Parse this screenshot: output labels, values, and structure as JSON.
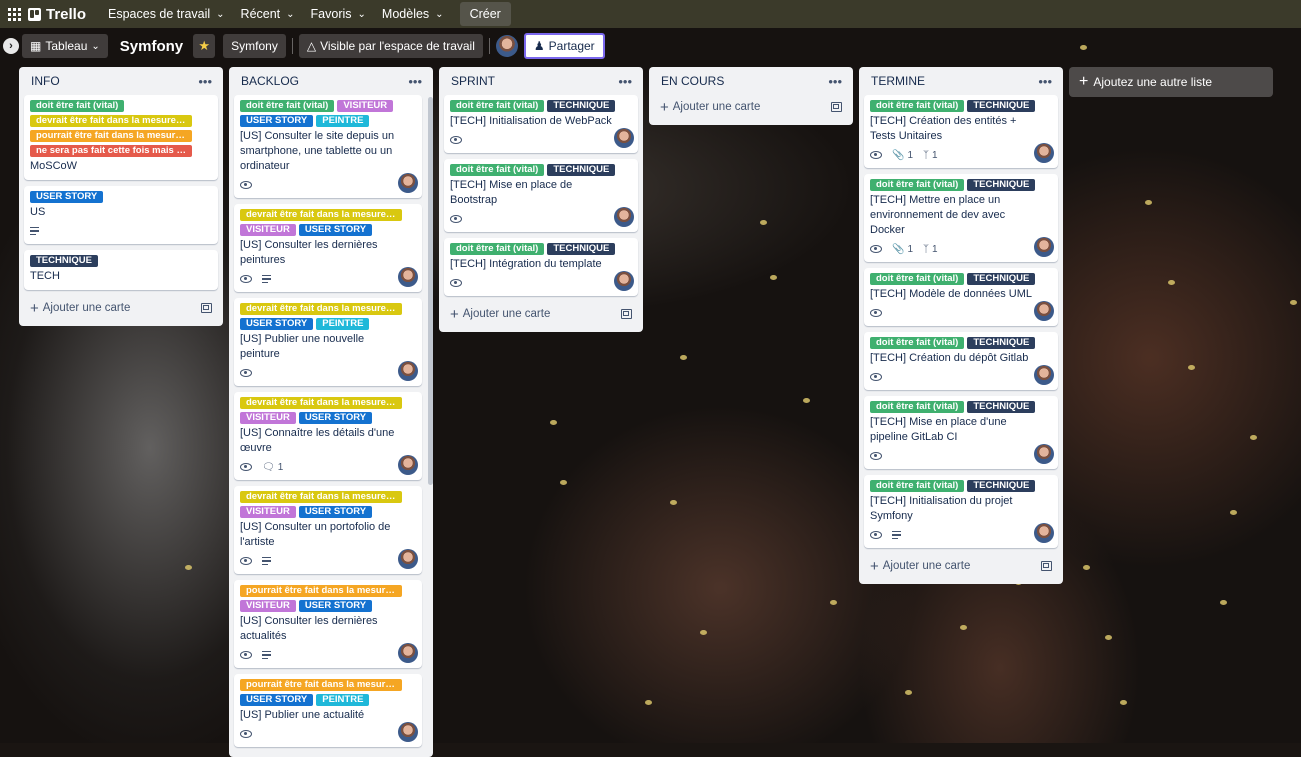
{
  "topnav": {
    "logo": "Trello",
    "items": [
      {
        "label": "Espaces de travail"
      },
      {
        "label": "Récent"
      },
      {
        "label": "Favoris"
      },
      {
        "label": "Modèles"
      }
    ],
    "create": "Créer"
  },
  "board": {
    "view": "Tableau",
    "title": "Symfony",
    "workspace": "Symfony",
    "visibility": "Visible par l'espace de travail",
    "share": "Partager"
  },
  "add_list": "Ajoutez une autre liste",
  "add_card": "Ajouter une carte",
  "lists": [
    {
      "title": "INFO",
      "cards": [
        {
          "labels": [
            {
              "text": "doit être fait (vital)",
              "color": "green"
            },
            {
              "text": "devrait être fait dans la mesure d...",
              "color": "yellow"
            },
            {
              "text": "pourrait être fait dans la mesure ...",
              "color": "orange"
            },
            {
              "text": "ne sera pas fait cette fois mais se...",
              "color": "red"
            }
          ],
          "title": "MoSCoW",
          "badges": []
        },
        {
          "labels": [
            {
              "text": "USER STORY",
              "color": "blue"
            }
          ],
          "title": "US",
          "badges": [
            "desc"
          ]
        },
        {
          "labels": [
            {
              "text": "TECHNIQUE",
              "color": "dark"
            }
          ],
          "title": "TECH",
          "badges": []
        }
      ]
    },
    {
      "title": "BACKLOG",
      "cards": [
        {
          "labels": [
            {
              "text": "doit être fait (vital)",
              "color": "green"
            },
            {
              "text": "VISITEUR",
              "color": "purple"
            },
            {
              "text": "USER STORY",
              "color": "blue"
            },
            {
              "text": "PEINTRE",
              "color": "cyan"
            }
          ],
          "title": "[US] Consulter le site depuis un smartphone, une tablette ou un ordinateur",
          "badges": [
            "watch"
          ],
          "avatar": true
        },
        {
          "labels": [
            {
              "text": "devrait être fait dans la mesure d...",
              "color": "yellow"
            },
            {
              "text": "VISITEUR",
              "color": "purple"
            },
            {
              "text": "USER STORY",
              "color": "blue"
            }
          ],
          "title": "[US] Consulter les dernières peintures",
          "badges": [
            "watch",
            "desc"
          ],
          "avatar": true
        },
        {
          "labels": [
            {
              "text": "devrait être fait dans la mesure d...",
              "color": "yellow"
            },
            {
              "text": "USER STORY",
              "color": "blue"
            },
            {
              "text": "PEINTRE",
              "color": "cyan"
            }
          ],
          "title": "[US] Publier une nouvelle peinture",
          "badges": [
            "watch"
          ],
          "avatar": true
        },
        {
          "labels": [
            {
              "text": "devrait être fait dans la mesure d...",
              "color": "yellow"
            },
            {
              "text": "VISITEUR",
              "color": "purple"
            },
            {
              "text": "USER STORY",
              "color": "blue"
            }
          ],
          "title": "[US] Connaître les détails d'une œuvre",
          "badges": [
            "watch",
            "comment"
          ],
          "comments": "1",
          "avatar": true
        },
        {
          "labels": [
            {
              "text": "devrait être fait dans la mesure d...",
              "color": "yellow"
            },
            {
              "text": "VISITEUR",
              "color": "purple"
            },
            {
              "text": "USER STORY",
              "color": "blue"
            }
          ],
          "title": "[US] Consulter un portofolio de l'artiste",
          "badges": [
            "watch",
            "desc"
          ],
          "avatar": true
        },
        {
          "labels": [
            {
              "text": "pourrait être fait dans la mesure ...",
              "color": "orange"
            },
            {
              "text": "VISITEUR",
              "color": "purple"
            },
            {
              "text": "USER STORY",
              "color": "blue"
            }
          ],
          "title": "[US] Consulter les dernières actualités",
          "badges": [
            "watch",
            "desc"
          ],
          "avatar": true
        },
        {
          "labels": [
            {
              "text": "pourrait être fait dans la mesure ...",
              "color": "orange"
            },
            {
              "text": "USER STORY",
              "color": "blue"
            },
            {
              "text": "PEINTRE",
              "color": "cyan"
            }
          ],
          "title": "[US] Publier une actualité",
          "badges": [
            "watch"
          ],
          "avatar": true
        }
      ]
    },
    {
      "title": "SPRINT",
      "cards": [
        {
          "labels": [
            {
              "text": "doit être fait (vital)",
              "color": "green"
            },
            {
              "text": "TECHNIQUE",
              "color": "dark"
            }
          ],
          "title": "[TECH] Initialisation de WebPack",
          "badges": [
            "watch"
          ],
          "avatar": true
        },
        {
          "labels": [
            {
              "text": "doit être fait (vital)",
              "color": "green"
            },
            {
              "text": "TECHNIQUE",
              "color": "dark"
            }
          ],
          "title": "[TECH] Mise en place de Bootstrap",
          "badges": [
            "watch"
          ],
          "avatar": true
        },
        {
          "labels": [
            {
              "text": "doit être fait (vital)",
              "color": "green"
            },
            {
              "text": "TECHNIQUE",
              "color": "dark"
            }
          ],
          "title": "[TECH] Intégration du template",
          "badges": [
            "watch"
          ],
          "avatar": true
        }
      ]
    },
    {
      "title": "EN COURS",
      "cards": []
    },
    {
      "title": "TERMINE",
      "cards": [
        {
          "labels": [
            {
              "text": "doit être fait (vital)",
              "color": "green"
            },
            {
              "text": "TECHNIQUE",
              "color": "dark"
            }
          ],
          "title": "[TECH] Création des entités + Tests Unitaires",
          "badges": [
            "watch",
            "attach",
            "branch"
          ],
          "attach": "1",
          "branch": "1",
          "avatar": true
        },
        {
          "labels": [
            {
              "text": "doit être fait (vital)",
              "color": "green"
            },
            {
              "text": "TECHNIQUE",
              "color": "dark"
            }
          ],
          "title": "[TECH] Mettre en place un environnement de dev avec Docker",
          "badges": [
            "watch",
            "attach",
            "branch"
          ],
          "attach": "1",
          "branch": "1",
          "avatar": true
        },
        {
          "labels": [
            {
              "text": "doit être fait (vital)",
              "color": "green"
            },
            {
              "text": "TECHNIQUE",
              "color": "dark"
            }
          ],
          "title": "[TECH] Modèle de données UML",
          "badges": [
            "watch"
          ],
          "avatar": true
        },
        {
          "labels": [
            {
              "text": "doit être fait (vital)",
              "color": "green"
            },
            {
              "text": "TECHNIQUE",
              "color": "dark"
            }
          ],
          "title": "[TECH] Création du dépôt Gitlab",
          "badges": [
            "watch"
          ],
          "avatar": true
        },
        {
          "labels": [
            {
              "text": "doit être fait (vital)",
              "color": "green"
            },
            {
              "text": "TECHNIQUE",
              "color": "dark"
            }
          ],
          "title": "[TECH] Mise en place d'une pipeline GitLab CI",
          "badges": [
            "watch"
          ],
          "avatar": true
        },
        {
          "labels": [
            {
              "text": "doit être fait (vital)",
              "color": "green"
            },
            {
              "text": "TECHNIQUE",
              "color": "dark"
            }
          ],
          "title": "[TECH] Initialisation du projet Symfony",
          "badges": [
            "watch",
            "desc"
          ],
          "avatar": true
        }
      ]
    }
  ]
}
